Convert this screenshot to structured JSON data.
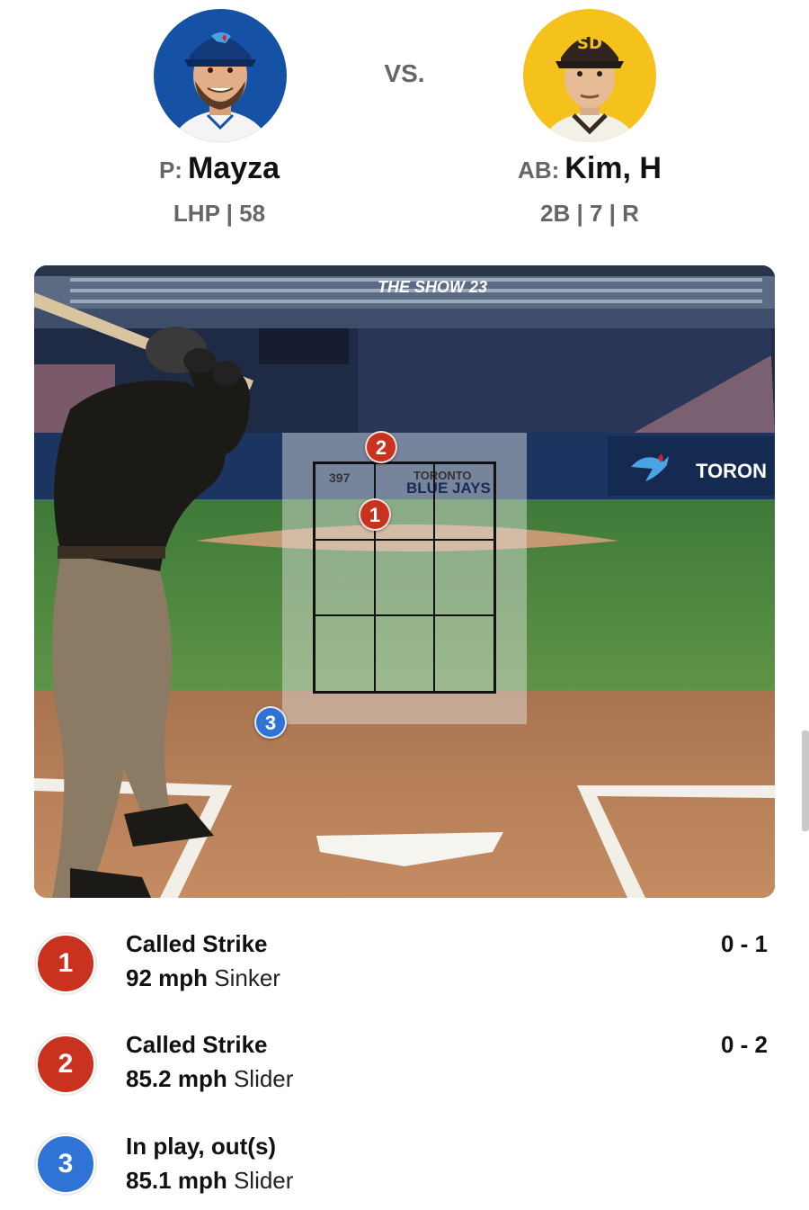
{
  "matchup": {
    "vs_label": "VS.",
    "pitcher": {
      "role": "P:",
      "name": "Mayza",
      "meta": "LHP | 58"
    },
    "batter": {
      "role": "AB:",
      "name": "Kim, H",
      "meta": "2B | 7 | R"
    }
  },
  "scene": {
    "game_logo": "THE SHOW 23",
    "zone_label": "397",
    "sign_city": "TORONTO",
    "sign_team": "BLUE JAYS",
    "wall_text": "TORON",
    "markers": [
      "2",
      "1",
      "3"
    ]
  },
  "pitches": [
    {
      "number": "1",
      "result": "Called Strike",
      "speed": "92 mph",
      "type": "Sinker",
      "count": "0 - 1",
      "color": "#c8321e"
    },
    {
      "number": "2",
      "result": "Called Strike",
      "speed": "85.2 mph",
      "type": "Slider",
      "count": "0 - 2",
      "color": "#c8321e"
    },
    {
      "number": "3",
      "result": "In play, out(s)",
      "speed": "85.1 mph",
      "type": "Slider",
      "count": "",
      "color": "#2f73d6"
    }
  ],
  "colors": {
    "strike": "#c8321e",
    "in_play": "#2f73d6",
    "pitcher_bg": "#1552a5",
    "batter_bg": "#f5c21b"
  }
}
